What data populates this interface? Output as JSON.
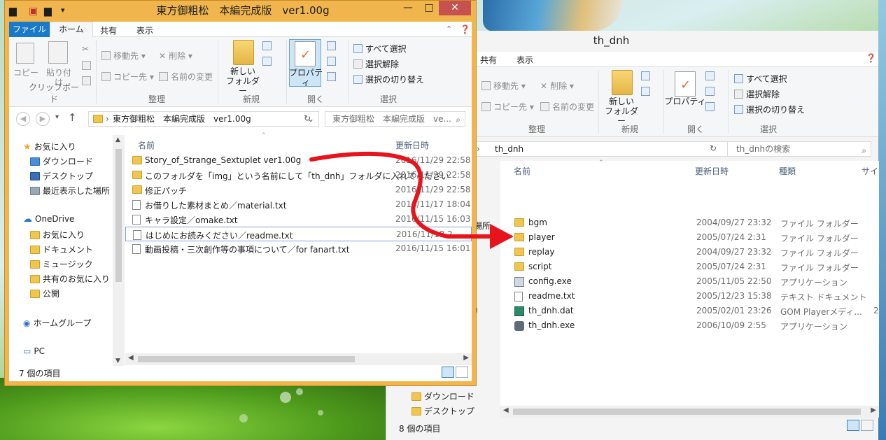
{
  "front": {
    "title": "東方御粗松　本編完成版　ver1.00g",
    "tabs": [
      "ファイル",
      "ホーム",
      "共有",
      "表示"
    ],
    "ribbon": {
      "clipboard": {
        "copy": "コピー",
        "paste": "貼り付け",
        "label": "クリップボード"
      },
      "organize": {
        "move": "移動先",
        "copy_to": "コピー先",
        "delete": "削除",
        "rename": "名前の変更",
        "label": "整理"
      },
      "new": {
        "new_folder": "新しい\nフォルダー",
        "label": "新規"
      },
      "open": {
        "properties": "プロパティ",
        "label": "開く"
      },
      "select": {
        "all": "すべて選択",
        "none": "選択解除",
        "invert": "選択の切り替え",
        "label": "選択"
      }
    },
    "address": "東方御粗松　本編完成版　ver1.00g",
    "search_placeholder": "東方御粗松　本編完成版　ve...",
    "nav": {
      "favorites": "お気に入り",
      "downloads": "ダウンロード",
      "desktop": "デスクトップ",
      "recent": "最近表示した場所",
      "onedrive": "OneDrive",
      "od_favorites": "お気に入り",
      "documents": "ドキュメント",
      "music": "ミュージック",
      "shared_favorites": "共有のお気に入り",
      "public": "公開",
      "homegroup": "ホームグループ",
      "pc": "PC"
    },
    "columns": {
      "name": "名前",
      "date": "更新日時"
    },
    "files": [
      {
        "name": "Story_of_Strange_Sextuplet ver1.00g",
        "date": "2016/11/29 22:58",
        "type": "folder"
      },
      {
        "name": "このフォルダを「img」という名前にして「th_dnh」フォルダに入れてください",
        "date": "2016/11/29 22:58",
        "type": "folder"
      },
      {
        "name": "修正パッチ",
        "date": "2016/11/29 22:58",
        "type": "folder"
      },
      {
        "name": "お借りした素材まとめ／material.txt",
        "date": "2016/11/17 18:04",
        "type": "doc"
      },
      {
        "name": "キャラ設定／omake.txt",
        "date": "2016/11/15 16:03",
        "type": "doc"
      },
      {
        "name": "はじめにお読みください／readme.txt",
        "date": "2016/11/18 2",
        "type": "doc"
      },
      {
        "name": "動画投稿・三次創作等の事項について／for fanart.txt",
        "date": "2016/11/15 16:01",
        "type": "doc"
      }
    ],
    "status": "7 個の項目"
  },
  "back": {
    "title": "th_dnh",
    "tabs": [
      "共有",
      "表示"
    ],
    "ribbon": {
      "organize": {
        "move": "移動先",
        "copy_to": "コピー先",
        "delete": "削除",
        "rename": "名前の変更",
        "label": "整理"
      },
      "new": {
        "new_folder": "新しい\nフォルダー",
        "label": "新規"
      },
      "open": {
        "properties": "プロパティ",
        "label": "開く"
      },
      "select": {
        "all": "すべて選択",
        "none": "選択解除",
        "invert": "選択の切り替え",
        "label": "選択"
      }
    },
    "address": "th_dnh",
    "search_placeholder": "th_dnhの検索",
    "columns": {
      "name": "名前",
      "date": "更新日時",
      "kind": "種類",
      "size": "サイ"
    },
    "files": [
      {
        "name": "bgm",
        "date": "2004/09/27 23:32",
        "kind": "ファイル フォルダー",
        "type": "folder"
      },
      {
        "name": "player",
        "date": "2005/07/24 2:31",
        "kind": "ファイル フォルダー",
        "type": "folder"
      },
      {
        "name": "replay",
        "date": "2004/09/27 23:32",
        "kind": "ファイル フォルダー",
        "type": "folder"
      },
      {
        "name": "script",
        "date": "2005/07/24 2:31",
        "kind": "ファイル フォルダー",
        "type": "folder"
      },
      {
        "name": "config.exe",
        "date": "2005/11/05 22:50",
        "kind": "アプリケーション",
        "type": "app"
      },
      {
        "name": "readme.txt",
        "date": "2005/12/23 15:38",
        "kind": "テキスト ドキュメント",
        "type": "doc"
      },
      {
        "name": "th_dnh.dat",
        "date": "2005/02/01 23:26",
        "kind": "GOM Playerメディ...",
        "type": "gom",
        "extra": "2"
      },
      {
        "name": "th_dnh.exe",
        "date": "2006/10/09 2:55",
        "kind": "アプリケーション",
        "type": "exe"
      }
    ],
    "nav_partial": {
      "place": "場所",
      "ri": "ﾘ"
    },
    "nav": {
      "downloads": "ダウンロード",
      "desktop": "デスクトップ"
    },
    "status": "8 個の項目"
  },
  "annotation": {
    "arrow_color": "#e8141b"
  },
  "colors": {
    "front_frame": "#f0b64d",
    "file_tab": "#1979ca",
    "close_button": "#c75050",
    "selection": "#cde6f7"
  }
}
